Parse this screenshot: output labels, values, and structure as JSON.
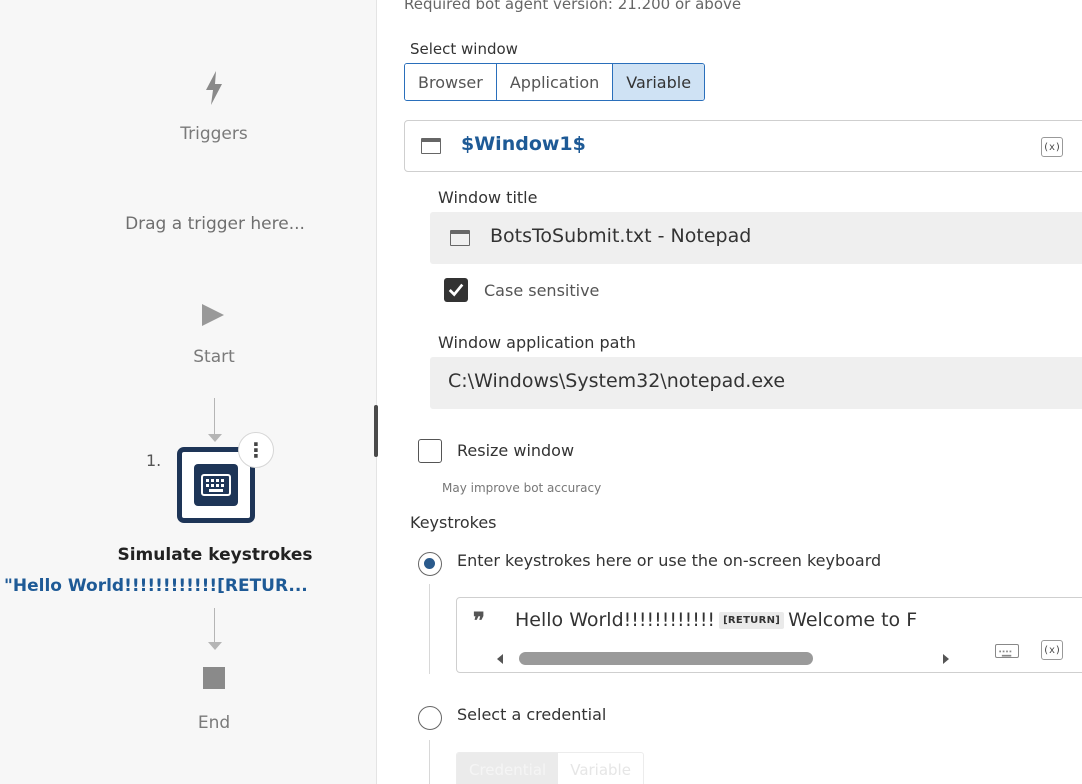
{
  "flow": {
    "triggers_label": "Triggers",
    "drag_hint": "Drag a trigger here...",
    "start_label": "Start",
    "step_number": "1.",
    "step_menu": "⋮",
    "step_title": "Simulate keystrokes",
    "step_preview": "\"Hello World!!!!!!!!!!!![RETUR...",
    "end_label": "End"
  },
  "props": {
    "required_version": "Required bot agent version: 21.200 or above",
    "select_window_label": "Select window",
    "window_tabs": [
      {
        "label": "Browser",
        "active": false
      },
      {
        "label": "Application",
        "active": false
      },
      {
        "label": "Variable",
        "active": true
      }
    ],
    "window_variable": "$Window1$",
    "var_button": "(x)",
    "window_title_label": "Window title",
    "window_title_value": "BotsToSubmit.txt - Notepad",
    "case_sensitive_label": "Case sensitive",
    "case_sensitive_checked": true,
    "app_path_label": "Window application path",
    "app_path_value": "C:\\Windows\\System32\\notepad.exe",
    "resize_label": "Resize window",
    "resize_checked": false,
    "resize_hint": "May improve bot accuracy",
    "keystrokes_label": "Keystrokes",
    "option_enter_label": "Enter keystrokes here or use the on-screen keyboard",
    "option_enter_selected": true,
    "keystroke_quote": "❞",
    "keystroke_part1": "Hello World!!!!!!!!!!!!",
    "keystroke_tag": "[RETURN]",
    "keystroke_part2": "Welcome to F",
    "option_credential_label": "Select a credential",
    "option_credential_selected": false,
    "credential_tabs": [
      "Credential",
      "Variable"
    ]
  },
  "colors": {
    "accent_blue": "#2a6fbb",
    "variable_text": "#1e5a96",
    "node_border": "#1e3557"
  }
}
